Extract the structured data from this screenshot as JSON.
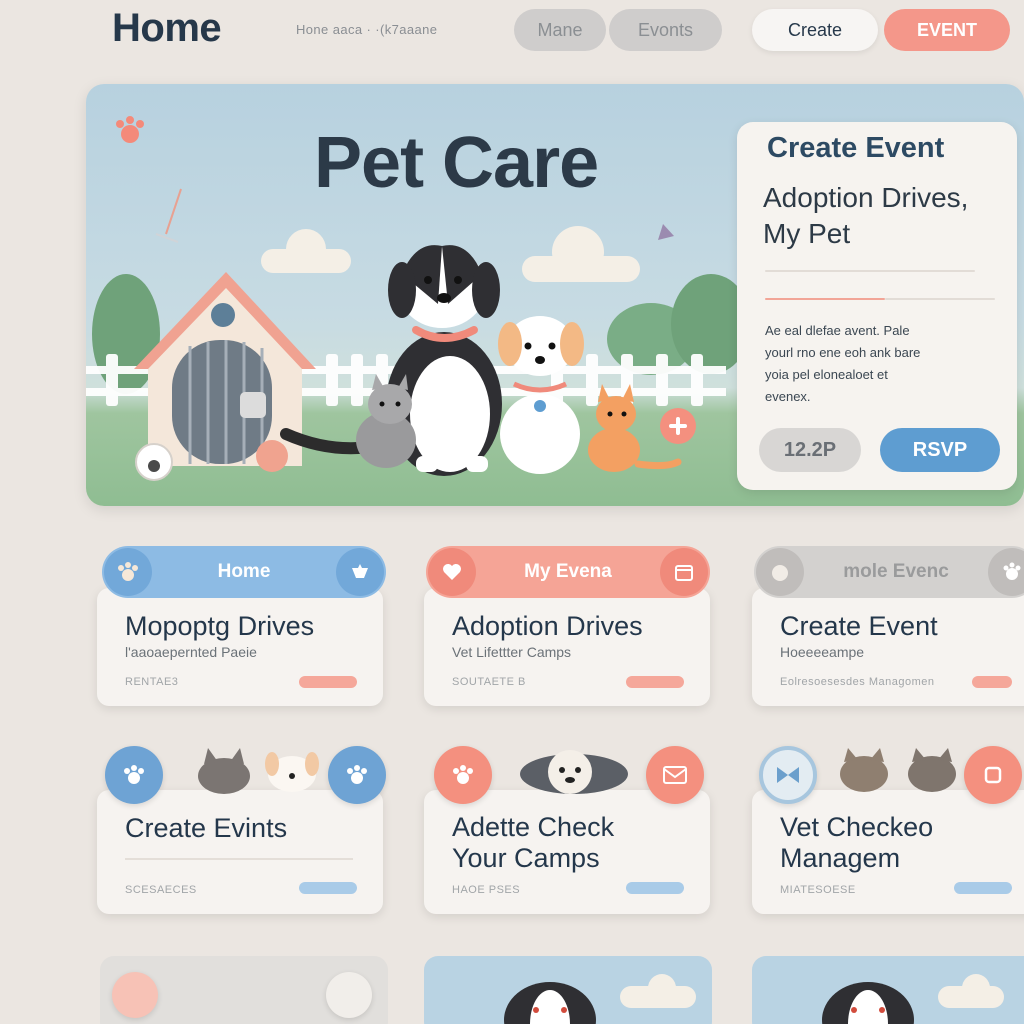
{
  "header": {
    "title": "Home",
    "breadcrumb": "Hone aaca · ·(k7aaane",
    "nav_grey_1": "Mane",
    "nav_grey_2": "Evonts",
    "create_label": "Create",
    "event_label": "EVENT"
  },
  "hero": {
    "title": "Pet Care",
    "panel": {
      "title": "Create Event",
      "subtitle_line1": "Adoption Drives,",
      "subtitle_line2": "My Pet",
      "body_line1": "Ae eal dlefae avent. Pale",
      "body_line2": "yourl rno ene eoh ank bare",
      "body_line3": "yoia pel elonealoet et",
      "body_line4": "evenex.",
      "count_label": "12.2P",
      "rsvp_label": "RSVP"
    }
  },
  "cards": [
    {
      "header": "Home",
      "title": "Mopoptg Drives",
      "subtitle": "l'aaoaepernted Paeie",
      "footer": "RENTAE3"
    },
    {
      "header": "My Evena",
      "title": "Adoption Drives",
      "subtitle": "Vet Lifettter Camps",
      "footer": "SOUTAETE B"
    },
    {
      "header": "mole Evenc",
      "title": "Create Event",
      "subtitle": "Hoeeeeampe",
      "footer": "Eolresoesesdes Managomen"
    },
    {
      "title": "Create Evints",
      "subtitle": "",
      "footer": "SCESAECES"
    },
    {
      "title_line1": "Adette Check",
      "title_line2": "Your Camps",
      "subtitle": "",
      "footer": "HAOE PSES"
    },
    {
      "title_line1": "Vet Checkeo",
      "title_line2": "Managem",
      "subtitle": "",
      "footer": "MIATESOESE"
    }
  ],
  "colors": {
    "background": "#ebe6e1",
    "accent_blue": "#5e9dd1",
    "accent_coral": "#f4978a",
    "text_dark": "#26384a"
  },
  "icons": [
    "paw-icon",
    "dog-icon",
    "cat-icon",
    "calendar-icon",
    "heart-icon"
  ]
}
